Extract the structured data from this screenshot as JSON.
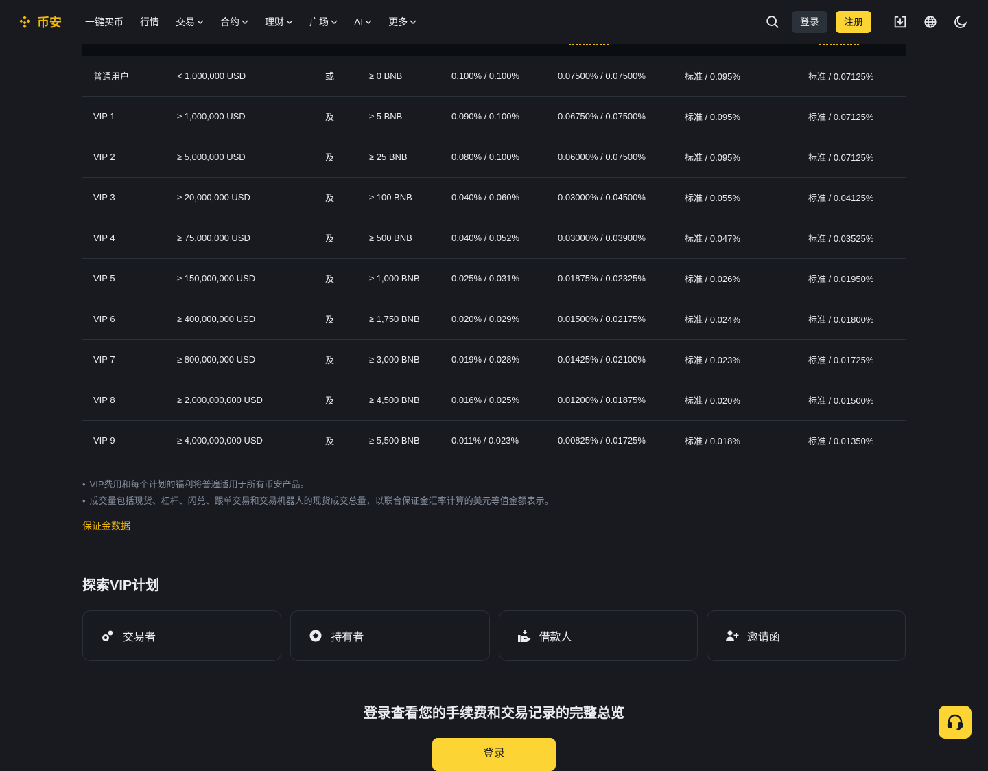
{
  "header": {
    "brand": "币安",
    "nav": [
      {
        "label": "一键买币",
        "dropdown": false
      },
      {
        "label": "行情",
        "dropdown": false
      },
      {
        "label": "交易",
        "dropdown": true
      },
      {
        "label": "合约",
        "dropdown": true
      },
      {
        "label": "理财",
        "dropdown": true
      },
      {
        "label": "广场",
        "dropdown": true
      },
      {
        "label": "AI",
        "dropdown": true
      },
      {
        "label": "更多",
        "dropdown": true
      }
    ],
    "login_label": "登录",
    "register_label": "注册"
  },
  "table": {
    "rows": [
      [
        "普通用户",
        "< 1,000,000 USD",
        "或",
        "≥ 0 BNB",
        "0.100% / 0.100%",
        "0.07500% / 0.07500%",
        "标准 / 0.095%",
        "标准 / 0.07125%"
      ],
      [
        "VIP 1",
        "≥ 1,000,000 USD",
        "及",
        "≥ 5 BNB",
        "0.090% / 0.100%",
        "0.06750% / 0.07500%",
        "标准 / 0.095%",
        "标准 / 0.07125%"
      ],
      [
        "VIP 2",
        "≥ 5,000,000 USD",
        "及",
        "≥ 25 BNB",
        "0.080% / 0.100%",
        "0.06000% / 0.07500%",
        "标准 / 0.095%",
        "标准 / 0.07125%"
      ],
      [
        "VIP 3",
        "≥ 20,000,000 USD",
        "及",
        "≥ 100 BNB",
        "0.040% / 0.060%",
        "0.03000% / 0.04500%",
        "标准 / 0.055%",
        "标准 / 0.04125%"
      ],
      [
        "VIP 4",
        "≥ 75,000,000 USD",
        "及",
        "≥ 500 BNB",
        "0.040% / 0.052%",
        "0.03000% / 0.03900%",
        "标准 / 0.047%",
        "标准 / 0.03525%"
      ],
      [
        "VIP 5",
        "≥ 150,000,000 USD",
        "及",
        "≥ 1,000 BNB",
        "0.025% / 0.031%",
        "0.01875% / 0.02325%",
        "标准 / 0.026%",
        "标准 / 0.01950%"
      ],
      [
        "VIP 6",
        "≥ 400,000,000 USD",
        "及",
        "≥ 1,750 BNB",
        "0.020% / 0.029%",
        "0.01500% / 0.02175%",
        "标准 / 0.024%",
        "标准 / 0.01800%"
      ],
      [
        "VIP 7",
        "≥ 800,000,000 USD",
        "及",
        "≥ 3,000 BNB",
        "0.019% / 0.028%",
        "0.01425% / 0.02100%",
        "标准 / 0.023%",
        "标准 / 0.01725%"
      ],
      [
        "VIP 8",
        "≥ 2,000,000,000 USD",
        "及",
        "≥ 4,500 BNB",
        "0.016% / 0.025%",
        "0.01200% / 0.01875%",
        "标准 / 0.020%",
        "标准 / 0.01500%"
      ],
      [
        "VIP 9",
        "≥ 4,000,000,000 USD",
        "及",
        "≥ 5,500 BNB",
        "0.011% / 0.023%",
        "0.00825% / 0.01725%",
        "标准 / 0.018%",
        "标准 / 0.01350%"
      ]
    ]
  },
  "notes": [
    "VIP费用和每个计划的福利将普遍适用于所有币安产品。",
    "成交量包括现货、杠杆、闪兑、跟单交易和交易机器人的现货成交总量，以联合保证金汇率计算的美元等值金额表示。"
  ],
  "margin_link": "保证金数据",
  "explore": {
    "title": "探索VIP计划",
    "cards": [
      {
        "label": "交易者",
        "icon": "trader-icon"
      },
      {
        "label": "持有者",
        "icon": "holder-icon"
      },
      {
        "label": "借款人",
        "icon": "borrower-icon"
      },
      {
        "label": "邀请函",
        "icon": "invite-icon"
      }
    ]
  },
  "cta": {
    "title": "登录查看您的手续费和交易记录的完整总览",
    "button_label": "登录"
  },
  "colors": {
    "bg": "#181a20",
    "accent": "#fcd535",
    "brand": "#f0b90b",
    "muted": "#848e9c"
  }
}
